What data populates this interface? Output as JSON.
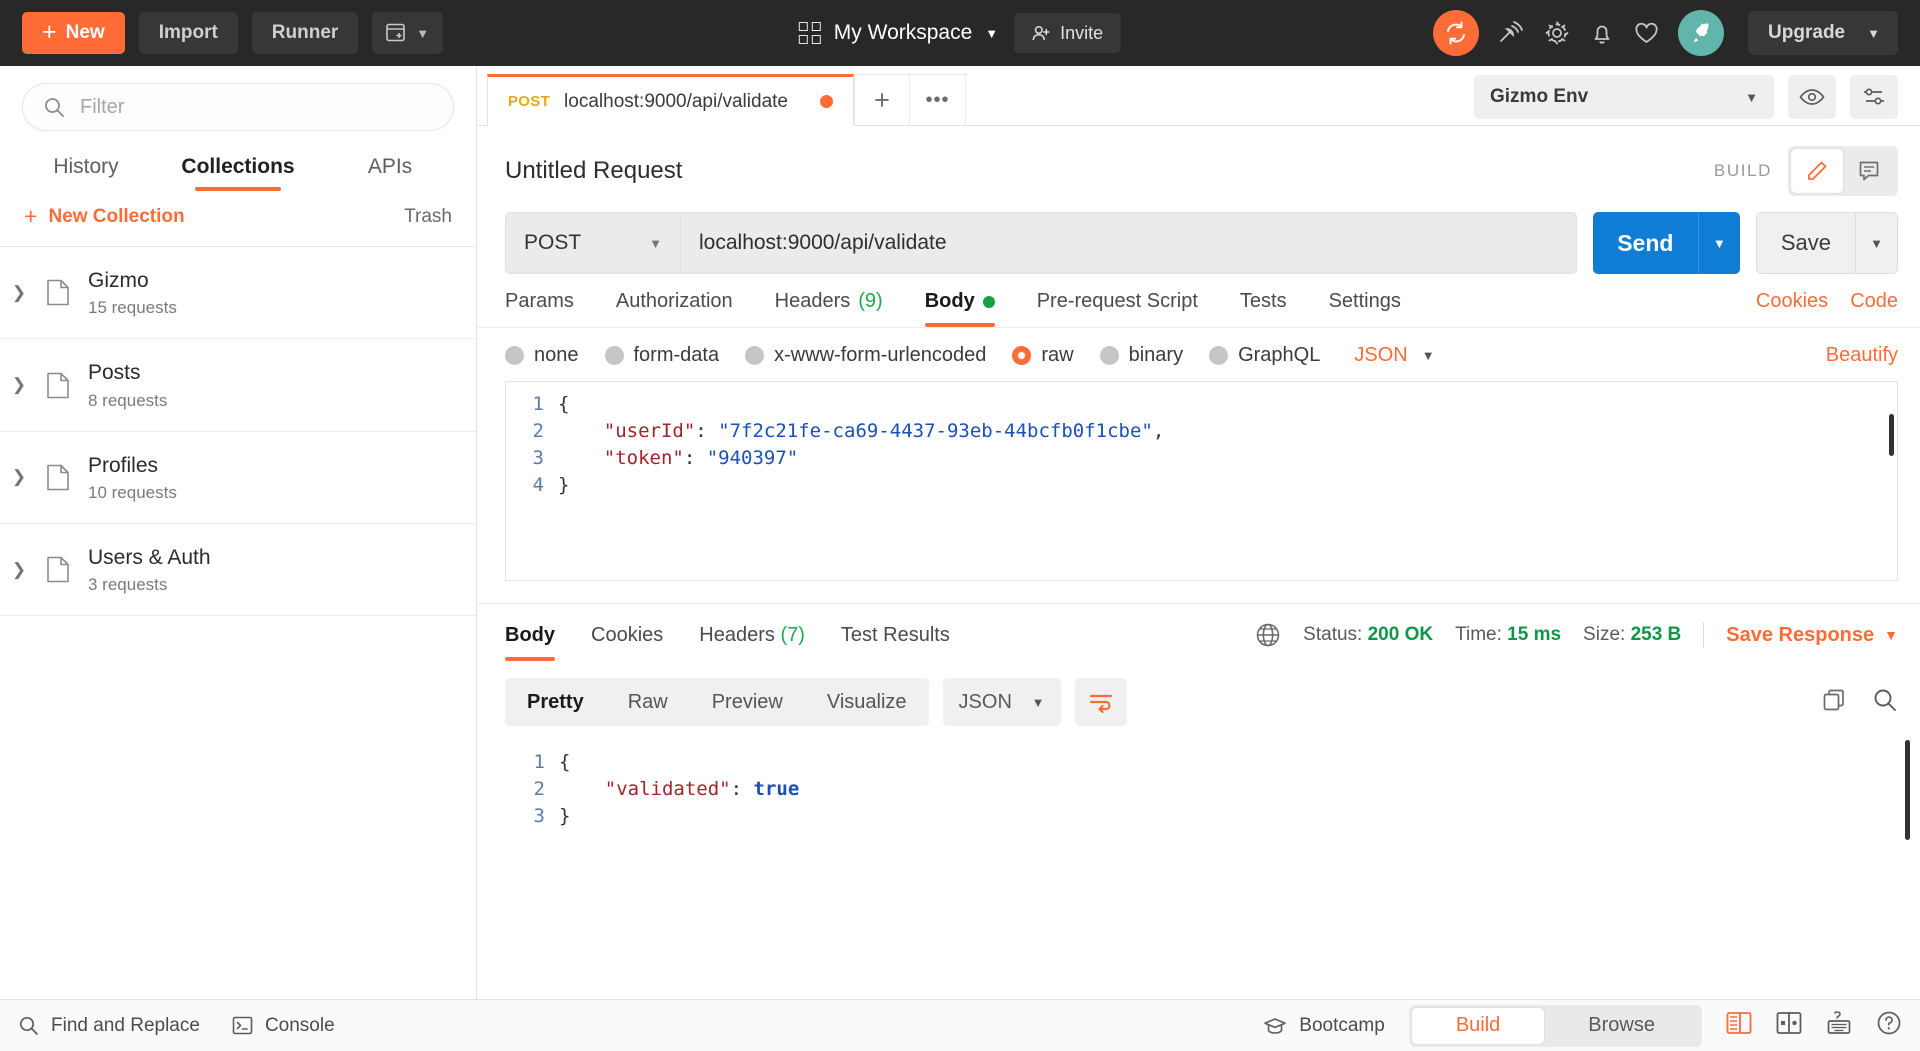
{
  "topbar": {
    "new_label": "New",
    "import_label": "Import",
    "runner_label": "Runner",
    "workspace_label": "My Workspace",
    "invite_label": "Invite",
    "upgrade_label": "Upgrade",
    "icons": [
      "new-window-icon",
      "sync-icon",
      "satellite-icon",
      "gear-icon",
      "bell-icon",
      "heart-icon",
      "rocket-icon"
    ],
    "accent": "#ff6c37",
    "bg": "#282828"
  },
  "sidebar": {
    "filter_placeholder": "Filter",
    "tabs": [
      {
        "label": "History",
        "active": false
      },
      {
        "label": "Collections",
        "active": true
      },
      {
        "label": "APIs",
        "active": false
      }
    ],
    "new_collection_label": "New Collection",
    "trash_label": "Trash",
    "collections": [
      {
        "name": "Gizmo",
        "requests": "15 requests"
      },
      {
        "name": "Posts",
        "requests": "8 requests"
      },
      {
        "name": "Profiles",
        "requests": "10 requests"
      },
      {
        "name": "Users & Auth",
        "requests": "3 requests"
      }
    ]
  },
  "tabstrip": {
    "request_tab": {
      "method": "POST",
      "url": "localhost:9000/api/validate",
      "unsaved": true
    },
    "add_label": "+",
    "more_label": "•••",
    "environment": "Gizmo Env"
  },
  "request": {
    "title": "Untitled Request",
    "build_label": "BUILD",
    "method": "POST",
    "url": "localhost:9000/api/validate",
    "send_label": "Send",
    "save_label": "Save",
    "tabs": [
      {
        "label": "Params",
        "active": false,
        "count": ""
      },
      {
        "label": "Authorization",
        "active": false,
        "count": ""
      },
      {
        "label": "Headers",
        "active": false,
        "count": "(9)"
      },
      {
        "label": "Body",
        "active": true,
        "count": ""
      },
      {
        "label": "Pre-request Script",
        "active": false,
        "count": ""
      },
      {
        "label": "Tests",
        "active": false,
        "count": ""
      },
      {
        "label": "Settings",
        "active": false,
        "count": ""
      }
    ],
    "cookies_label": "Cookies",
    "code_label": "Code",
    "body_types": [
      {
        "label": "none",
        "selected": false
      },
      {
        "label": "form-data",
        "selected": false
      },
      {
        "label": "x-www-form-urlencoded",
        "selected": false
      },
      {
        "label": "raw",
        "selected": true
      },
      {
        "label": "binary",
        "selected": false
      },
      {
        "label": "GraphQL",
        "selected": false
      }
    ],
    "raw_format": "JSON",
    "beautify_label": "Beautify",
    "body_lines": [
      {
        "num": "1",
        "tokens": [
          {
            "t": "{",
            "c": "p"
          }
        ]
      },
      {
        "num": "2",
        "tokens": [
          {
            "t": "    ",
            "c": "p"
          },
          {
            "t": "\"userId\"",
            "c": "k"
          },
          {
            "t": ": ",
            "c": "p"
          },
          {
            "t": "\"7f2c21fe-ca69-4437-93eb-44bcfb0f1cbe\"",
            "c": "s"
          },
          {
            "t": ",",
            "c": "p"
          }
        ]
      },
      {
        "num": "3",
        "tokens": [
          {
            "t": "    ",
            "c": "p"
          },
          {
            "t": "\"token\"",
            "c": "k"
          },
          {
            "t": ": ",
            "c": "p"
          },
          {
            "t": "\"940397\"",
            "c": "s"
          }
        ]
      },
      {
        "num": "4",
        "tokens": [
          {
            "t": "}",
            "c": "p"
          }
        ]
      }
    ]
  },
  "response": {
    "tabs": [
      {
        "label": "Body",
        "active": true,
        "count": ""
      },
      {
        "label": "Cookies",
        "active": false,
        "count": ""
      },
      {
        "label": "Headers",
        "active": false,
        "count": "(7)"
      },
      {
        "label": "Test Results",
        "active": false,
        "count": ""
      }
    ],
    "status_label": "Status:",
    "status_value": "200 OK",
    "time_label": "Time:",
    "time_value": "15 ms",
    "size_label": "Size:",
    "size_value": "253 B",
    "save_response_label": "Save Response",
    "views": [
      {
        "label": "Pretty",
        "active": true
      },
      {
        "label": "Raw",
        "active": false
      },
      {
        "label": "Preview",
        "active": false
      },
      {
        "label": "Visualize",
        "active": false
      }
    ],
    "format": "JSON",
    "body_lines": [
      {
        "num": "1",
        "tokens": [
          {
            "t": "{",
            "c": "p"
          }
        ]
      },
      {
        "num": "2",
        "tokens": [
          {
            "t": "    ",
            "c": "p"
          },
          {
            "t": "\"validated\"",
            "c": "k"
          },
          {
            "t": ": ",
            "c": "p"
          },
          {
            "t": "true",
            "c": "b"
          }
        ]
      },
      {
        "num": "3",
        "tokens": [
          {
            "t": "}",
            "c": "p"
          }
        ]
      }
    ]
  },
  "footer": {
    "find_replace_label": "Find and Replace",
    "console_label": "Console",
    "bootcamp_label": "Bootcamp",
    "build_label": "Build",
    "browse_label": "Browse"
  }
}
